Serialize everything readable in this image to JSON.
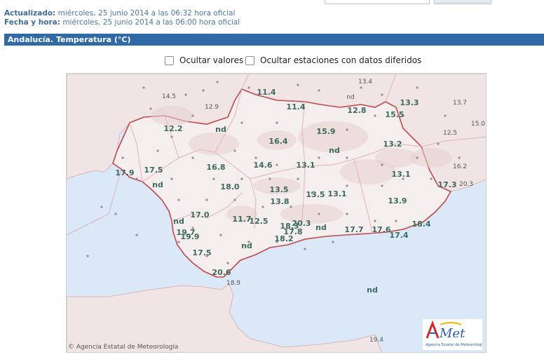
{
  "header": {
    "updated_label": "Actualizado:",
    "updated_value": "miércoles, 25 junio 2014 a las 06:32 hora oficial",
    "datetime_label": "Fecha y hora:",
    "datetime_value": "miércoles, 25 junio 2014 a las 06:00 hora oficial"
  },
  "panel": {
    "title": "Andalucía. Temperatura (°C)"
  },
  "options": {
    "hide_values": "Ocultar valores",
    "hide_deferred": "Ocultar estaciones con datos diferidos"
  },
  "map": {
    "credit": "Agencia Estatal de Meteorología",
    "logo_text": "AEMet",
    "logo_subtext": "Agencia Estatal de Meteorología",
    "colors": {
      "sea": "#dbe8f7",
      "land": "#f0e4e4",
      "andalucia": "#f5eeee",
      "border": "#c0484a",
      "label": "#3c6a60"
    },
    "stations": [
      {
        "t": "11.4",
        "major": true
      },
      {
        "t": "13.4",
        "major": false
      },
      {
        "t": "nd",
        "major": false
      },
      {
        "t": "14.5",
        "major": false
      },
      {
        "t": "12.9",
        "major": false
      },
      {
        "t": "11.4",
        "major": true
      },
      {
        "t": "12.8",
        "major": true
      },
      {
        "t": "13.3",
        "major": true
      },
      {
        "t": "13.7",
        "major": false
      },
      {
        "t": "15.5",
        "major": true
      },
      {
        "t": "12.2",
        "major": true
      },
      {
        "t": "nd",
        "major": true
      },
      {
        "t": "15.9",
        "major": true
      },
      {
        "t": "12.5",
        "major": false
      },
      {
        "t": "15.0",
        "major": false
      },
      {
        "t": "16.4",
        "major": true
      },
      {
        "t": "13.2",
        "major": true
      },
      {
        "t": "nd",
        "major": true
      },
      {
        "t": "17.9",
        "major": true
      },
      {
        "t": "17.5",
        "major": true
      },
      {
        "t": "16.8",
        "major": true
      },
      {
        "t": "14.6",
        "major": true
      },
      {
        "t": "13.1",
        "major": true
      },
      {
        "t": "16.2",
        "major": false
      },
      {
        "t": "nd",
        "major": true
      },
      {
        "t": "13.1",
        "major": true
      },
      {
        "t": "18.0",
        "major": true
      },
      {
        "t": "17.3",
        "major": true
      },
      {
        "t": "20.3",
        "major": false
      },
      {
        "t": "13.5",
        "major": true
      },
      {
        "t": "13.5",
        "major": true
      },
      {
        "t": "13.1",
        "major": true
      },
      {
        "t": "13.8",
        "major": true
      },
      {
        "t": "13.9",
        "major": true
      },
      {
        "t": "17.0",
        "major": true
      },
      {
        "t": "11.7",
        "major": true
      },
      {
        "t": "12.5",
        "major": true
      },
      {
        "t": "nd",
        "major": true
      },
      {
        "t": "18.3",
        "major": true
      },
      {
        "t": "20.3",
        "major": true
      },
      {
        "t": "nd",
        "major": true
      },
      {
        "t": "17.7",
        "major": true
      },
      {
        "t": "17.6",
        "major": true
      },
      {
        "t": "18.4",
        "major": true
      },
      {
        "t": "19.7",
        "major": true
      },
      {
        "t": "17.8",
        "major": true
      },
      {
        "t": "19.9",
        "major": true
      },
      {
        "t": "18.2",
        "major": true
      },
      {
        "t": "17.4",
        "major": true
      },
      {
        "t": "nd",
        "major": true
      },
      {
        "t": "17.5",
        "major": true
      },
      {
        "t": "20.6",
        "major": true
      },
      {
        "t": "18.9",
        "major": false
      },
      {
        "t": "nd",
        "major": true
      },
      {
        "t": "19.4",
        "major": false
      }
    ]
  }
}
